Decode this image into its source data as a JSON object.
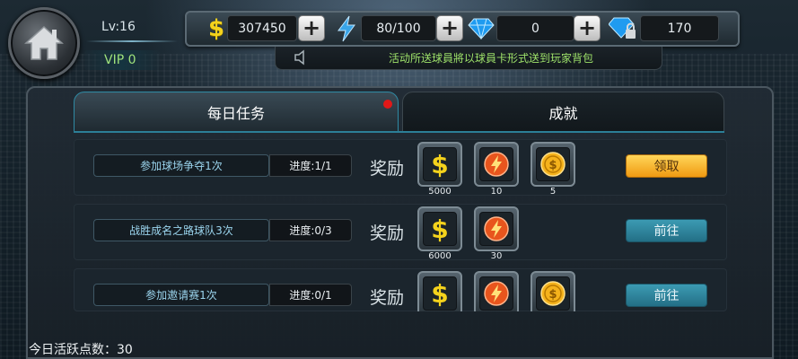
{
  "header": {
    "level": "Lv:16",
    "vip": "VIP 0"
  },
  "resources": {
    "coins": "307450",
    "energy": "80/100",
    "diamonds": "0",
    "locked_diamonds": "170"
  },
  "notice": "活动所送球員將以球員卡形式送到玩家背包",
  "tabs": [
    {
      "label": "每日任务",
      "active": true
    },
    {
      "label": "成就",
      "active": false
    }
  ],
  "reward_label": "奖励",
  "tasks": [
    {
      "name": "参加球场争夺1次",
      "progress": "进度:1/1",
      "rewards": [
        {
          "icon": "dollar-icon",
          "amount": "5000"
        },
        {
          "icon": "energy-icon",
          "amount": "10"
        },
        {
          "icon": "gold-coin-icon",
          "amount": "5"
        }
      ],
      "button": "领取",
      "button_type": "claim"
    },
    {
      "name": "战胜成名之路球队3次",
      "progress": "进度:0/3",
      "rewards": [
        {
          "icon": "dollar-icon",
          "amount": "6000"
        },
        {
          "icon": "energy-icon",
          "amount": "30"
        }
      ],
      "button": "前往",
      "button_type": "go"
    },
    {
      "name": "参加邀请赛1次",
      "progress": "进度:0/1",
      "rewards": [
        {
          "icon": "dollar-icon",
          "amount": ""
        },
        {
          "icon": "energy-icon",
          "amount": ""
        },
        {
          "icon": "gold-coin-icon",
          "amount": ""
        }
      ],
      "button": "前往",
      "button_type": "go"
    }
  ],
  "footer": {
    "activity_points": "今日活跃点数：30"
  },
  "colors": {
    "accent": "#2f8aa4",
    "claim": "#f0a417",
    "go": "#2f86a0",
    "vip": "#9fe27b",
    "notice": "#9ee26a"
  }
}
